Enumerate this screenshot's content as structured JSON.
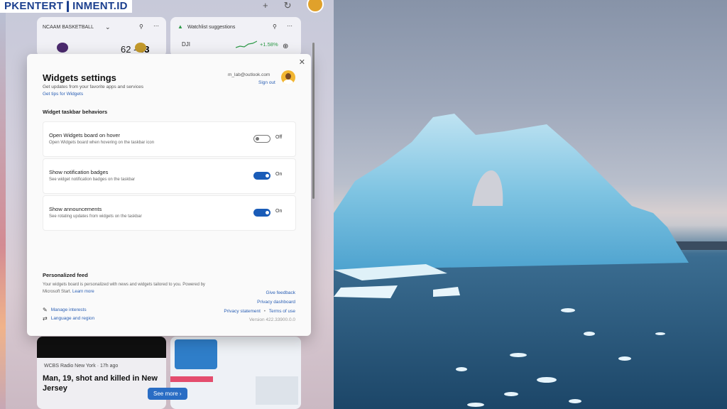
{
  "watermark": {
    "text": "PKENTERT❙INMENT.ID"
  },
  "board": {
    "ncaa_card": {
      "title": "NCAAM BASKETBALL",
      "score_left": "62",
      "score_sep": "-",
      "score_right": "63"
    },
    "watchlist_card": {
      "title": "Watchlist suggestions",
      "ticker": "DJI",
      "change": "+1.58%"
    },
    "news_card": {
      "source": "WCBS Radio New York · 17h ago",
      "headline": "Man, 19, shot and killed in New Jersey",
      "see_more": "See more"
    }
  },
  "dialog": {
    "title": "Widgets settings",
    "subtitle": "Get updates from your favorite apps and services",
    "tips_link": "Get tips for Widgets",
    "email": "m_lab@outlook.com",
    "sign_out": "Sign out",
    "section_title": "Widget taskbar behaviors",
    "settings": [
      {
        "title": "Open Widgets board on hover",
        "description": "Open Widgets board when hovering on the taskbar icon",
        "state": "Off"
      },
      {
        "title": "Show notification badges",
        "description": "See widget notification badges on the taskbar",
        "state": "On"
      },
      {
        "title": "Show announcements",
        "description": "See rotating updates from widgets on the taskbar",
        "state": "On"
      }
    ],
    "personalized": {
      "title": "Personalized feed",
      "description": "Your widgets board is personalized with news and widgets tailored to you. Powered by Microsoft Start.",
      "learn_more": "Learn more",
      "manage_interests": "Manage interests",
      "language_region": "Language and region"
    },
    "links": {
      "feedback": "Give feedback",
      "privacy_dashboard": "Privacy dashboard",
      "privacy_statement": "Privacy statement",
      "separator": "•",
      "terms": "Terms of use",
      "version": "Version 422.33900.0.0"
    }
  },
  "colors": {
    "accent": "#1a5cb8",
    "link": "#2a5fb4"
  }
}
